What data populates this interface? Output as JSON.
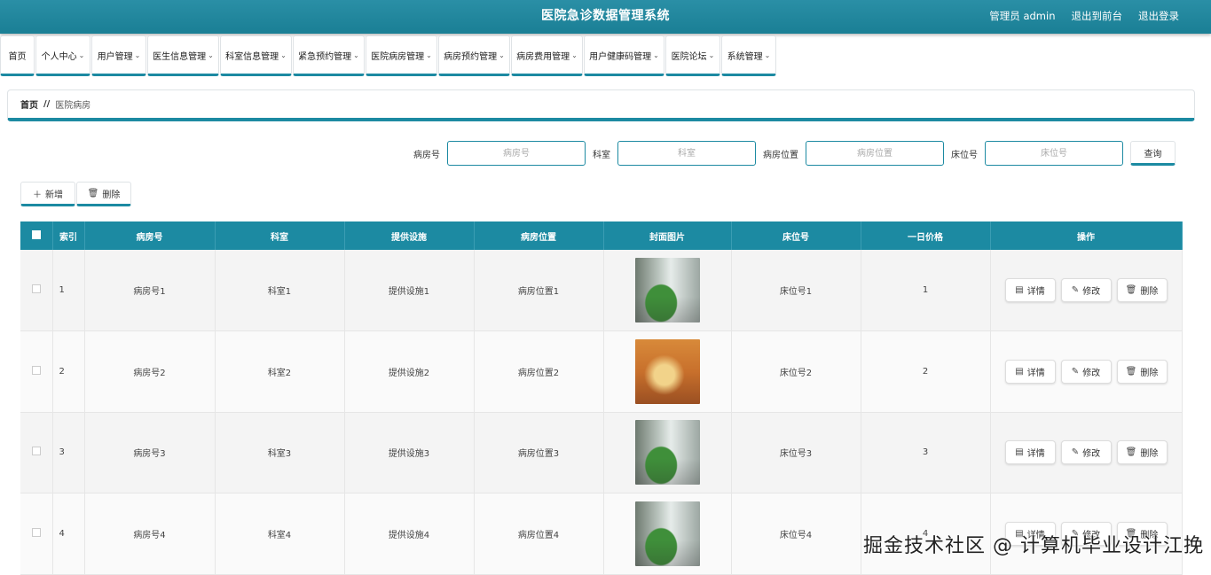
{
  "header": {
    "title": "医院急诊数据管理系统",
    "user": "管理员 admin",
    "to_front": "退出到前台",
    "logout": "退出登录"
  },
  "nav": {
    "items": [
      {
        "label": "首页",
        "dropdown": false
      },
      {
        "label": "个人中心",
        "dropdown": true
      },
      {
        "label": "用户管理",
        "dropdown": true
      },
      {
        "label": "医生信息管理",
        "dropdown": true
      },
      {
        "label": "科室信息管理",
        "dropdown": true
      },
      {
        "label": "紧急预约管理",
        "dropdown": true
      },
      {
        "label": "医院病房管理",
        "dropdown": true
      },
      {
        "label": "病房预约管理",
        "dropdown": true
      },
      {
        "label": "病房费用管理",
        "dropdown": true
      },
      {
        "label": "用户健康码管理",
        "dropdown": true
      },
      {
        "label": "医院论坛",
        "dropdown": true
      },
      {
        "label": "系统管理",
        "dropdown": true
      }
    ]
  },
  "breadcrumb": {
    "home": "首页",
    "sep": "//",
    "current": "医院病房"
  },
  "search": {
    "room_no_label": "病房号",
    "room_no_placeholder": "病房号",
    "dept_label": "科室",
    "dept_placeholder": "科室",
    "location_label": "病房位置",
    "location_placeholder": "病房位置",
    "bed_label": "床位号",
    "bed_placeholder": "床位号",
    "query_label": "查询"
  },
  "actions": {
    "add_label": "新增",
    "delete_label": "删除"
  },
  "table": {
    "headers": [
      "索引",
      "病房号",
      "科室",
      "提供设施",
      "病房位置",
      "封面图片",
      "床位号",
      "一日价格",
      "操作"
    ],
    "rows": [
      {
        "index": "1",
        "room": "病房号1",
        "dept": "科室1",
        "facility": "提供设施1",
        "location": "病房位置1",
        "image": "hospital-corridor-green",
        "bed": "床位号1",
        "price": "1"
      },
      {
        "index": "2",
        "room": "病房号2",
        "dept": "科室2",
        "facility": "提供设施2",
        "location": "病房位置2",
        "image": "hospital-lobby-orange",
        "bed": "床位号2",
        "price": "2"
      },
      {
        "index": "3",
        "room": "病房号3",
        "dept": "科室3",
        "facility": "提供设施3",
        "location": "病房位置3",
        "image": "hospital-corridor-green",
        "bed": "床位号3",
        "price": "3"
      },
      {
        "index": "4",
        "room": "病房号4",
        "dept": "科室4",
        "facility": "提供设施4",
        "location": "病房位置4",
        "image": "hospital-corridor-green",
        "bed": "床位号4",
        "price": "4"
      }
    ],
    "op_detail": "详情",
    "op_edit": "修改",
    "op_delete": "删除"
  },
  "watermark": "掘金技术社区 @ 计算机毕业设计江挽",
  "colors": {
    "primary": "#1c8aa2",
    "header": "#1a7f95"
  }
}
